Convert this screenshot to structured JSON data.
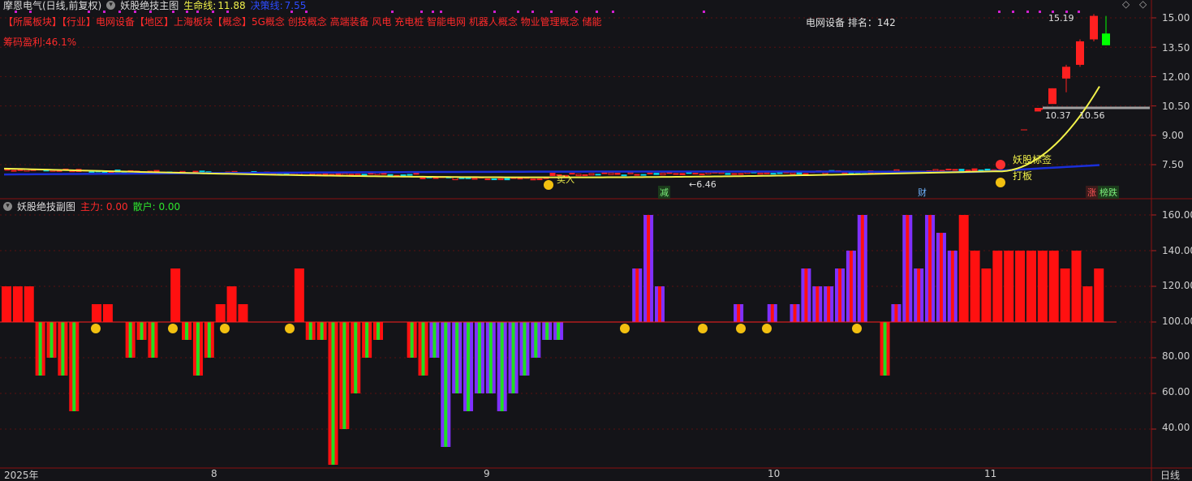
{
  "main_chart": {
    "stock_name": "摩恩电气(日线,前复权)",
    "indicator_title": "妖股绝技主图",
    "life_line_label": "生命线:",
    "life_line_value": "11.88",
    "decision_line_label": "决策线:",
    "decision_line_value": "7.55",
    "tags_text": "【所属板块】【行业】电网设备【地区】上海板块【概念】5G概念 创投概念 高端装备 风电 充电桩 智能电网 机器人概念 物业管理概念 储能",
    "chip_profit": "筹码盈利:46.1%",
    "rank_text": "电网设备 排名：142",
    "price_high_label": "15.19",
    "support_label_left": "10.37",
    "support_label_right": "10.56",
    "low_label": "6.46",
    "buy_label": "买入",
    "tag_yaogu": "妖股标签",
    "tag_daban": "打板",
    "event_jian": "减",
    "event_cai": "财",
    "event_zhang": "涨",
    "event_bangdie": "榜跌",
    "y_ticks": [
      "15.00",
      "13.50",
      "12.00",
      "10.50",
      "9.00",
      "7.50"
    ],
    "colors": {
      "life_line": "#f2f24a",
      "decision_line": "#1a2fd8",
      "up": "#ff2020",
      "down": "#00ff00",
      "muted": "#00d5e8"
    }
  },
  "sub_chart": {
    "indicator_title": "妖股绝技副图",
    "main_force_label": "主力: 0.00",
    "retail_label": "散户: 0.00",
    "y_ticks": [
      "160.00",
      "140.00",
      "120.00",
      "100.00",
      "80.00",
      "60.00",
      "40.00"
    ]
  },
  "x_axis": {
    "labels": [
      "2025年",
      "8",
      "9",
      "10",
      "11"
    ],
    "period": "日线"
  },
  "chart_data": [
    {
      "type": "candlestick",
      "title": "妖股绝技主图",
      "ylim": [
        6.1,
        15.6
      ],
      "series": [
        {
          "name": "生命线",
          "color": "#f2f24a"
        },
        {
          "name": "决策线",
          "color": "#1a2fd8"
        }
      ],
      "candles_late": [
        {
          "o": 10.3,
          "c": 10.4,
          "h": 10.4,
          "l": 10.3,
          "dir": "up"
        },
        {
          "o": 10.6,
          "c": 11.4,
          "h": 11.4,
          "l": 10.9,
          "dir": "up"
        },
        {
          "o": 11.9,
          "c": 12.5,
          "h": 12.6,
          "l": 11.2,
          "dir": "up"
        },
        {
          "o": 12.6,
          "c": 13.8,
          "h": 13.9,
          "l": 12.5,
          "dir": "up"
        },
        {
          "o": 13.9,
          "c": 15.1,
          "h": 15.19,
          "l": 13.8,
          "dir": "up"
        },
        {
          "o": 14.2,
          "c": 13.6,
          "h": 15.1,
          "l": 13.6,
          "dir": "down"
        }
      ]
    },
    {
      "type": "bar",
      "title": "妖股绝技副图",
      "baseline": 100,
      "ylim": [
        25,
        165
      ],
      "values": [
        120,
        120,
        120,
        70,
        80,
        70,
        50,
        100,
        110,
        110,
        100,
        80,
        90,
        80,
        100,
        130,
        90,
        70,
        80,
        110,
        120,
        110,
        100,
        100,
        100,
        100,
        130,
        90,
        90,
        20,
        40,
        60,
        80,
        90,
        100,
        100,
        80,
        70,
        80,
        30,
        60,
        50,
        60,
        60,
        50,
        60,
        70,
        80,
        90,
        90,
        100,
        100,
        100,
        100,
        100,
        100,
        130,
        160,
        120,
        100,
        100,
        100,
        100,
        100,
        100,
        110,
        100,
        100,
        110,
        100,
        110,
        130,
        120,
        120,
        130,
        140,
        160,
        100,
        70,
        110,
        160,
        130,
        160,
        150,
        140,
        160,
        140,
        130,
        140,
        140,
        140,
        140,
        140,
        140,
        130,
        140,
        120,
        130,
        100
      ]
    }
  ]
}
